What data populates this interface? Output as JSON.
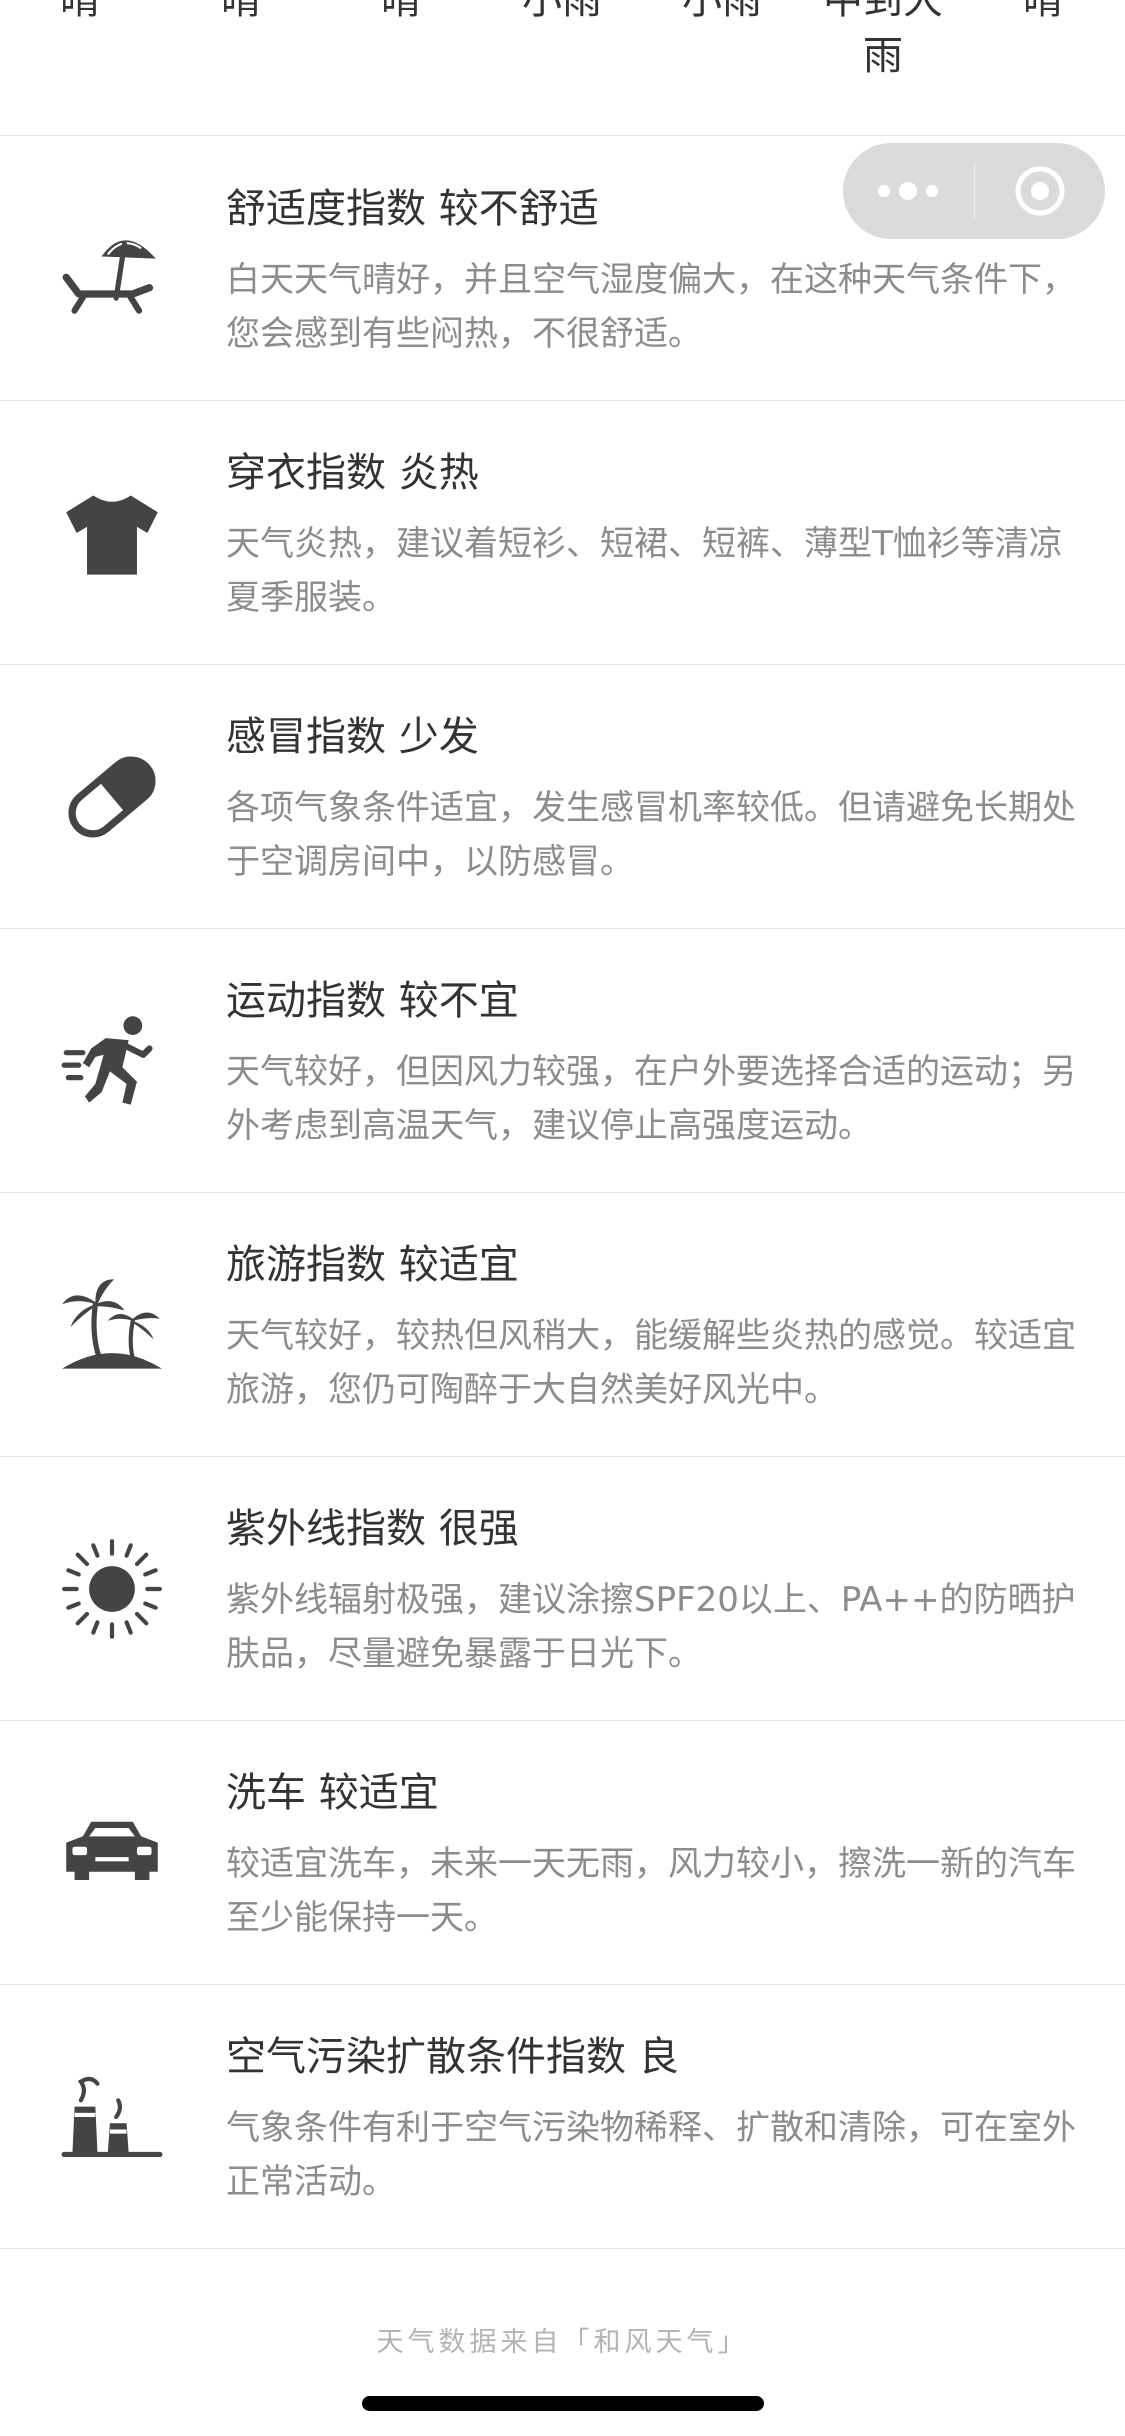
{
  "forecast": {
    "conditions": [
      "晴",
      "晴",
      "晴",
      "小雨",
      "小雨",
      "中到大雨",
      "晴"
    ]
  },
  "capsule": {
    "more_icon": "more-dots-icon",
    "close_icon": "target-circle-icon",
    "background": "#d7d7d7"
  },
  "indices": [
    {
      "icon": "beach-umbrella-icon",
      "title": "舒适度指数 较不舒适",
      "desc": "白天天气晴好，并且空气湿度偏大，在这种天气条件下，您会感到有些闷热，不很舒适。"
    },
    {
      "icon": "tshirt-icon",
      "title": "穿衣指数 炎热",
      "desc": "天气炎热，建议着短衫、短裙、短裤、薄型T恤衫等清凉夏季服装。"
    },
    {
      "icon": "pill-icon",
      "title": "感冒指数 少发",
      "desc": "各项气象条件适宜，发生感冒机率较低。但请避免长期处于空调房间中，以防感冒。"
    },
    {
      "icon": "running-person-icon",
      "title": "运动指数 较不宜",
      "desc": "天气较好，但因风力较强，在户外要选择合适的运动；另外考虑到高温天气，建议停止高强度运动。"
    },
    {
      "icon": "palm-island-icon",
      "title": "旅游指数 较适宜",
      "desc": "天气较好，较热但风稍大，能缓解些炎热的感觉。较适宜旅游，您仍可陶醉于大自然美好风光中。"
    },
    {
      "icon": "sun-icon",
      "title": "紫外线指数 很强",
      "desc": "紫外线辐射极强，建议涂擦SPF20以上、PA++的防晒护肤品，尽量避免暴露于日光下。"
    },
    {
      "icon": "car-icon",
      "title": "洗车 较适宜",
      "desc": "较适宜洗车，未来一天无雨，风力较小，擦洗一新的汽车至少能保持一天。"
    },
    {
      "icon": "factory-icon",
      "title": "空气污染扩散条件指数 良",
      "desc": "气象条件有利于空气污染物稀释、扩散和清除，可在室外正常活动。"
    }
  ],
  "footer": {
    "credit": "天气数据来自「和风天气」"
  },
  "colors": {
    "title": "#333333",
    "desc": "#8c8c8c",
    "icon": "#444444",
    "divider": "#e6e6e6"
  }
}
